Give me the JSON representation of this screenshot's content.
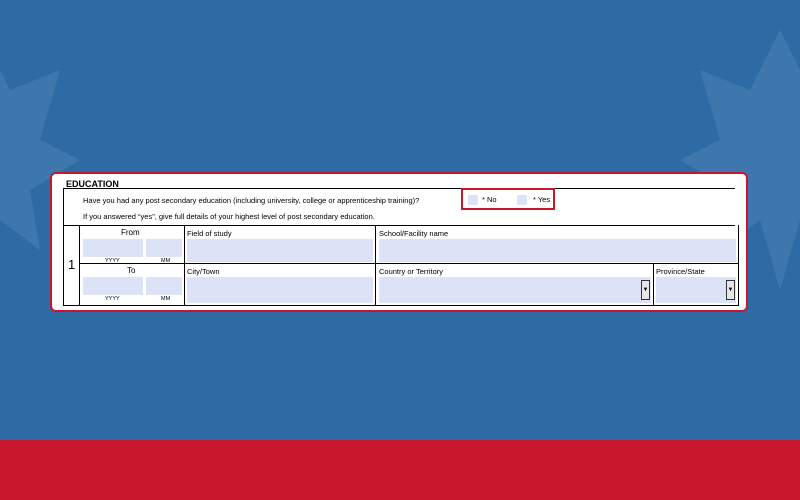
{
  "section": {
    "title": "EDUCATION",
    "question": "Have you had any post secondary education (including university, college or apprenticeship training)?",
    "instruction": "If you answered “yes”, give full details of your highest level of post secondary education.",
    "options": {
      "no": "* No",
      "yes": "* Yes"
    }
  },
  "entry": {
    "number": "1",
    "from_label": "From",
    "to_label": "To",
    "yyyy_label": "YYYY",
    "mm_label": "MM",
    "field_of_study_label": "Field of study",
    "school_label": "School/Facility name",
    "city_label": "City/Town",
    "country_label": "Country or Territory",
    "province_label": "Province/State"
  },
  "colors": {
    "background": "#2e6aa3",
    "accent_red": "#c8172c",
    "field_fill": "#dde3f7"
  },
  "icons": {
    "dropdown": "triangle-down"
  }
}
